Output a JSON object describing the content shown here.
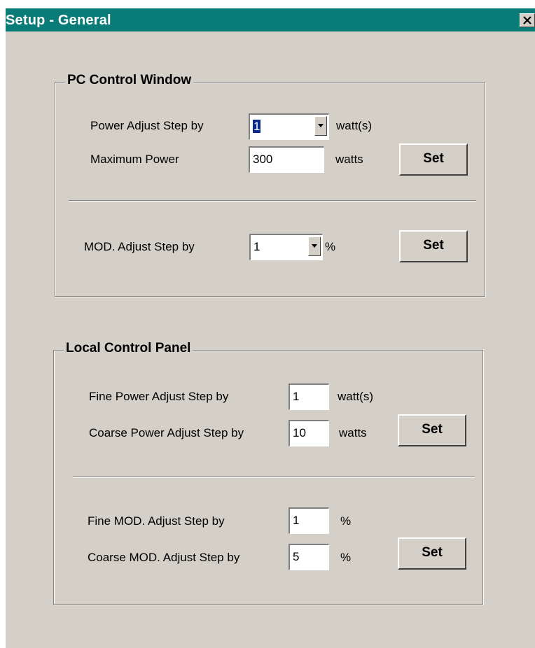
{
  "window": {
    "title": "Setup - General"
  },
  "pc_control": {
    "title": "PC Control Window",
    "power_step_label": "Power Adjust Step by",
    "power_step_value": "1",
    "power_step_unit": "watt(s)",
    "max_power_label": "Maximum Power",
    "max_power_value": "300",
    "max_power_unit": "watts",
    "set_label": "Set",
    "mod_step_label": "MOD. Adjust Step by",
    "mod_step_value": "1",
    "mod_step_unit": "%",
    "mod_set_label": "Set"
  },
  "local_control": {
    "title": "Local Control Panel",
    "fine_power_label": "Fine Power Adjust Step by",
    "fine_power_value": "1",
    "fine_power_unit": "watt(s)",
    "coarse_power_label": "Coarse Power Adjust Step by",
    "coarse_power_value": "10",
    "coarse_power_unit": "watts",
    "power_set_label": "Set",
    "fine_mod_label": "Fine MOD. Adjust Step by",
    "fine_mod_value": "1",
    "fine_mod_unit": "%",
    "coarse_mod_label": "Coarse MOD. Adjust Step by",
    "coarse_mod_value": "5",
    "coarse_mod_unit": "%",
    "mod_set_label": "Set"
  },
  "colors": {
    "titlebar": "#0a7c78",
    "dialog_bg": "#d4d0c8",
    "selection": "#0a2a8a"
  },
  "icons": {
    "close": "close-icon",
    "dropdown": "chevron-down-icon"
  }
}
